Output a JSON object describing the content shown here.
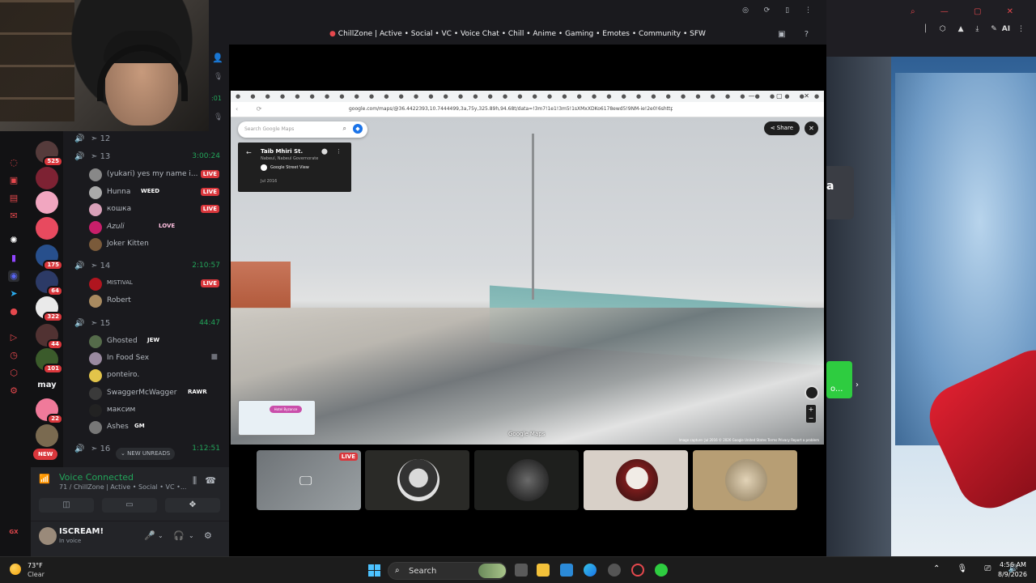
{
  "webcam": {
    "label": "webcam overlay"
  },
  "server_rail": {
    "badges": [
      "525",
      "175",
      "64",
      "322",
      "44",
      "101",
      "22"
    ],
    "text_server": "may",
    "new_label": "NEW"
  },
  "channels": {
    "vc12": {
      "name": "12"
    },
    "vc13": {
      "name": "13",
      "time": "3:00:24"
    },
    "vc13_users": [
      {
        "name": "(yukari) yes my name i...",
        "tag": "",
        "live": "LIVE"
      },
      {
        "name": "Hunnа",
        "tag": "WEED",
        "live": "LIVE"
      },
      {
        "name": "кошка",
        "tag": "",
        "live": "LIVE"
      },
      {
        "name": "Azuli",
        "tag": "LOVE",
        "live": ""
      },
      {
        "name": "Joker Kitten",
        "tag": "",
        "live": ""
      }
    ],
    "vc14": {
      "name": "14",
      "time": "2:10:57"
    },
    "vc14_users": [
      {
        "name": "MISTIVAL",
        "tag": "",
        "live": "LIVE"
      },
      {
        "name": "Robert",
        "tag": "",
        "live": ""
      }
    ],
    "vc15": {
      "name": "15",
      "time": "44:47"
    },
    "vc15_users": [
      {
        "name": "Ghosted",
        "tag": "JEW"
      },
      {
        "name": "In Food Sex",
        "tag": ""
      },
      {
        "name": "ponteiro.",
        "tag": ""
      },
      {
        "name": "SwaggerMcWagger",
        "tag": "RAWR"
      },
      {
        "name": "максим",
        "tag": ""
      },
      {
        "name": "Ashes",
        "tag": "GM"
      }
    ],
    "vc16": {
      "name": "16",
      "time": "1:12:51"
    },
    "new_unreads": "NEW UNREADS"
  },
  "voice": {
    "status": "Voice Connected",
    "channel": "71 / ChillZone | Active • Social • VC •..."
  },
  "user": {
    "name": "ISCREAM!",
    "status": "In voice"
  },
  "top_bar": {
    "title": "ChillZone | Active • Social • VC • Voice Chat • Chill • Anime • Gaming • Emotes • Community • SFW"
  },
  "browser": {
    "url": "google.com/maps/@36.4422393,10.7444499,3a,75y,325.89h,94.68t/data=!3m7!1e1!3m5!1sXMxXDKo6178ewd5!9NM-ie!2e0!6shttps:%2F%2Fstreet"
  },
  "maps": {
    "search_placeholder": "Search Google Maps",
    "street": "Taib Mhiri St.",
    "region": "Nabeul, Nabeul Governorate",
    "street_view": "Google Street View",
    "date": "Jul 2016",
    "share": "Share",
    "brand": "Google Maps",
    "minimap_place": "Hotel Byzance",
    "credits": "Image capture: Jul 2016   © 2026 Google   United States   Terms   Privacy   Report a problem"
  },
  "tiles": {
    "live": "LIVE"
  },
  "right_app": {
    "ai_label": "AI",
    "dark_letter": "a",
    "green_text": "o..."
  },
  "taskbar": {
    "temperature": "73°F",
    "condition": "Clear",
    "search": "Search",
    "time": "4:56 AM",
    "date": "8/9/2026"
  }
}
